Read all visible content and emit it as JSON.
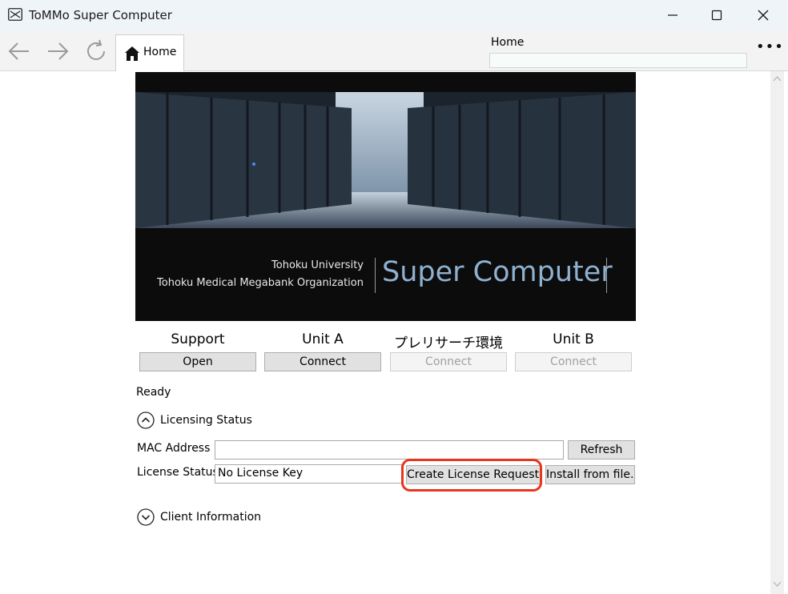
{
  "window": {
    "title": "ToMMo Super Computer"
  },
  "toolbar": {
    "tab_label": "Home",
    "address_label": "Home",
    "address_value": "",
    "more_label": "•••"
  },
  "banner": {
    "org_line1": "Tohoku University",
    "org_line2": "Tohoku Medical Megabank Organization",
    "title": "Super Computer"
  },
  "services": [
    {
      "label": "Support",
      "button": "Open",
      "enabled": true
    },
    {
      "label": "Unit A",
      "button": "Connect",
      "enabled": true
    },
    {
      "label": "プレリサーチ環境",
      "button": "Connect",
      "enabled": false
    },
    {
      "label": "Unit B",
      "button": "Connect",
      "enabled": false
    }
  ],
  "status_text": "Ready",
  "licensing": {
    "header": "Licensing Status",
    "expanded": true,
    "mac_label": "MAC Address",
    "mac_value": "",
    "refresh_label": "Refresh",
    "license_label": "License Status",
    "license_value": "No License Key",
    "create_request_label": "Create License Request...",
    "install_label": "Install from file..."
  },
  "client_info": {
    "header": "Client Information",
    "expanded": false
  },
  "colors": {
    "highlight": "#e8351c",
    "banner_title": "#8fb1d1"
  }
}
